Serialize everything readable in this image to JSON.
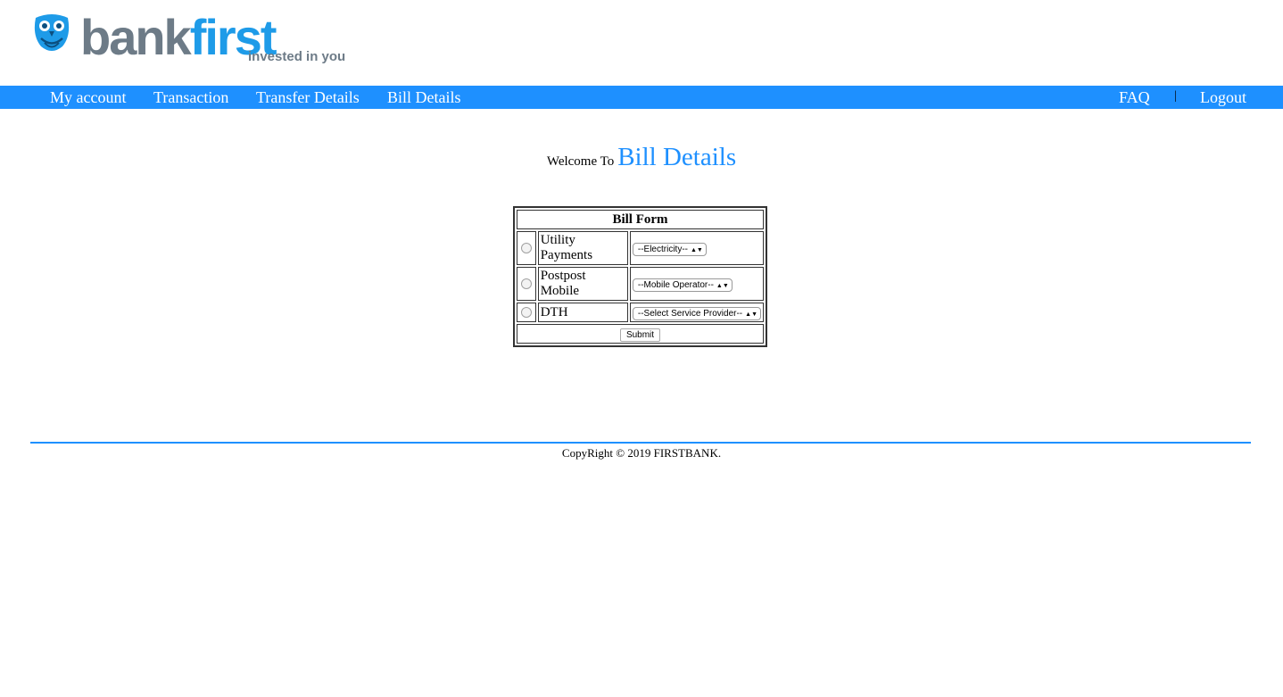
{
  "brand": {
    "name_part1": "bank",
    "name_part2": "first",
    "tagline": "invested in you",
    "colors": {
      "grey": "#6d7b87",
      "blue": "#1e9be8"
    }
  },
  "nav": {
    "items": [
      "My account",
      "Transaction",
      "Transfer Details",
      "Bill Details"
    ],
    "right": [
      "FAQ",
      "Logout"
    ],
    "separator": "|",
    "bg_color": "#1e90ff"
  },
  "welcome": {
    "prefix": "Welcome To",
    "title": "Bill Details"
  },
  "bill_form": {
    "heading": "Bill Form",
    "rows": [
      {
        "label": "Utility Payments",
        "select": "--Electricity--"
      },
      {
        "label": "Postpost Mobile",
        "select": "--Mobile Operator--"
      },
      {
        "label": "DTH",
        "select": "--Select Service Provider--"
      }
    ],
    "submit_label": "Submit"
  },
  "footer": {
    "text": "CopyRight © 2019 FIRSTBANK."
  }
}
